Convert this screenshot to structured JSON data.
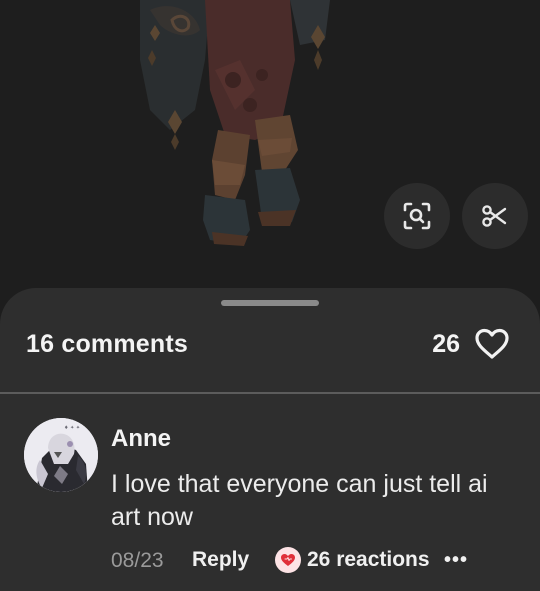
{
  "artwork": {
    "icon": "artwork-preview"
  },
  "floating_actions": {
    "visual_search_icon": "lens-search-icon",
    "cutout_icon": "scissors-icon"
  },
  "sheet": {
    "comment_count_label": "16 comments",
    "like_count": "26",
    "like_icon": "heart-outline-icon"
  },
  "comments": [
    {
      "author": "Anne",
      "text": "I love that everyone can just tell ai art now",
      "timestamp": "08/23",
      "reply_label": "Reply",
      "reactions_label": "26 reactions",
      "reaction_icon": "heart-reaction-icon",
      "more_label": "•••"
    }
  ],
  "colors": {
    "background": "#1d1d1d",
    "sheet": "#2e2e2e",
    "divider": "#5c5c5c",
    "muted_text": "#9a9a9a",
    "reaction_red": "#e0303a"
  }
}
